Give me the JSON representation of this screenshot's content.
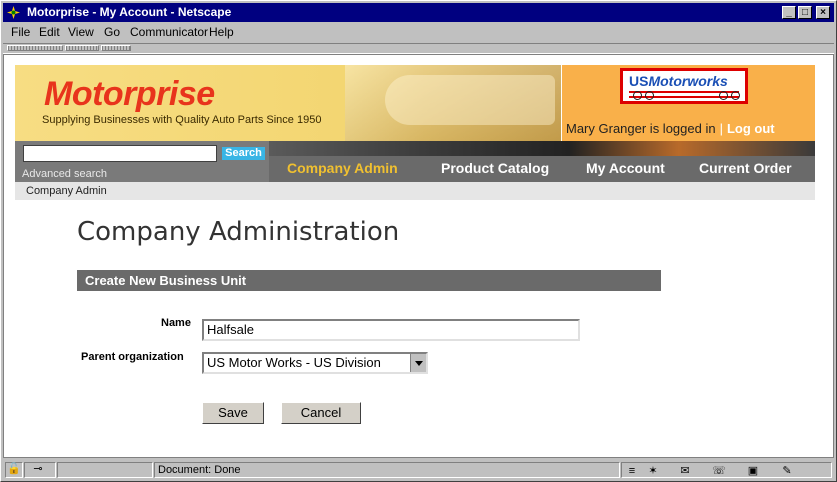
{
  "window": {
    "title": "Motorprise - My Account - Netscape"
  },
  "menu": [
    "File",
    "Edit",
    "View",
    "Go",
    "Communicator",
    "Help"
  ],
  "header": {
    "brand": "Motorprise",
    "tagline": "Supplying Businesses with Quality Auto Parts Since 1950",
    "partner_logo_us": "US",
    "partner_logo_motorworks": "Motorworks",
    "user_status": "Mary Granger is logged in",
    "separator": "|",
    "logout_label": "Log out"
  },
  "search": {
    "button_label": "Search",
    "advanced_label": "Advanced search",
    "value": ""
  },
  "nav": {
    "items": [
      {
        "label": "Company Admin",
        "active": true
      },
      {
        "label": "Product Catalog",
        "active": false
      },
      {
        "label": "My Account",
        "active": false
      },
      {
        "label": "Current Order",
        "active": false
      }
    ]
  },
  "breadcrumb": "Company Admin",
  "page": {
    "title": "Company Administration",
    "section_title": "Create New Business Unit",
    "name_label": "Name",
    "name_value": "Halfsale",
    "parent_label": "Parent organization",
    "parent_value": "US Motor Works - US Division",
    "save_label": "Save",
    "cancel_label": "Cancel"
  },
  "status": {
    "text": "Document: Done"
  },
  "colors": {
    "brand_red": "#e8341c",
    "nav_active": "#f0c030",
    "search_button": "#39b5e5",
    "title_bar": "#000080"
  }
}
